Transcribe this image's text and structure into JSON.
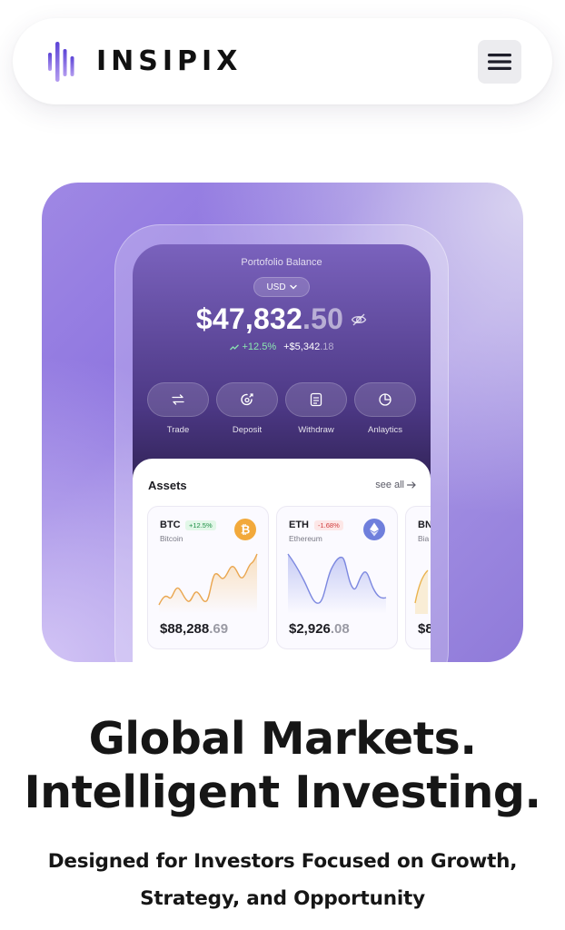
{
  "header": {
    "brand": "INSIPIX",
    "menu_icon": "hamburger-menu-icon"
  },
  "colors": {
    "brand_purple": "#7b5fe0",
    "hero_bg": "#9a84e2",
    "positive": "#8be7b0",
    "btc": "#f2a93b",
    "eth": "#6f7fdc"
  },
  "portfolio": {
    "title": "Portofolio Balance",
    "currency": "USD",
    "balance_main": "$47,832",
    "balance_decimal": ".50",
    "change_pct": "+12.5%",
    "change_amt_main": "+$5,342",
    "change_amt_decimal": ".18"
  },
  "actions": [
    {
      "label": "Trade",
      "icon": "swap-arrows-icon"
    },
    {
      "label": "Deposit",
      "icon": "deposit-icon"
    },
    {
      "label": "Withdraw",
      "icon": "withdraw-icon"
    },
    {
      "label": "Anlaytics",
      "icon": "pie-chart-icon"
    }
  ],
  "assets": {
    "title": "Assets",
    "see_all": "see all",
    "coins": [
      {
        "symbol": "BTC",
        "name": "Bitcoin",
        "change": "+12.5%",
        "price_main": "$88,288",
        "price_decimal": ".69",
        "trend": "up"
      },
      {
        "symbol": "ETH",
        "name": "Ethereum",
        "change": "-1.68%",
        "price_main": "$2,926",
        "price_decimal": ".08",
        "trend": "down"
      },
      {
        "symbol": "BN",
        "name": "Bia",
        "price_main": "$8"
      }
    ]
  },
  "hero_text": {
    "headline_line1": "Global Markets.",
    "headline_line2": "Intelligent Investing.",
    "subline_line1": "Designed for Investors Focused on Growth,",
    "subline_line2": "Strategy, and Opportunity"
  }
}
